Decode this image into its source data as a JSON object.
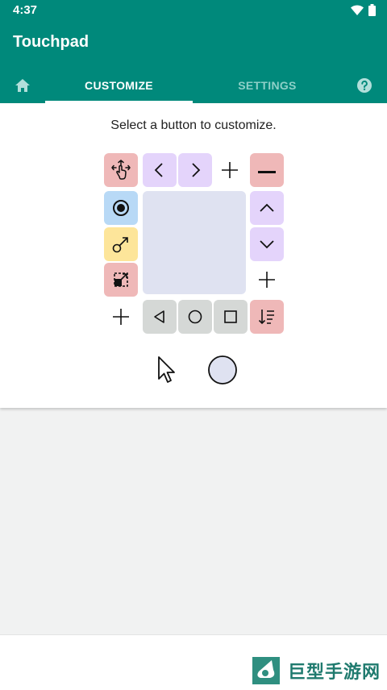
{
  "status_bar": {
    "time": "4:37",
    "wifi_icon": "wifi-icon",
    "battery_icon": "battery-icon"
  },
  "app": {
    "title": "Touchpad",
    "accent_color": "#00897b"
  },
  "tabs": [
    {
      "id": "home",
      "icon": "home-icon",
      "label": ""
    },
    {
      "id": "customize",
      "label": "CUSTOMIZE",
      "selected": true
    },
    {
      "id": "settings",
      "label": "SETTINGS",
      "selected": false
    },
    {
      "id": "help",
      "icon": "help-icon",
      "label": ""
    }
  ],
  "customize": {
    "instruction": "Select a button to customize.",
    "buttons": [
      {
        "name": "move-gesture",
        "icon": "hand-move-icon",
        "color": "#efb8b8"
      },
      {
        "name": "left",
        "icon": "chevron-left-icon",
        "color": "#e4d4fb"
      },
      {
        "name": "right",
        "icon": "chevron-right-icon",
        "color": "#e4d4fb"
      },
      {
        "name": "add-top",
        "icon": "plus-icon"
      },
      {
        "name": "minus",
        "icon": "minus-icon",
        "color": "#efb8b8"
      },
      {
        "name": "record",
        "icon": "radio-button-icon",
        "color": "#b8d9f6"
      },
      {
        "name": "up",
        "icon": "chevron-up-icon",
        "color": "#e4d4fb"
      },
      {
        "name": "pointer-drag",
        "icon": "pointer-drag-icon",
        "color": "#fde59a"
      },
      {
        "name": "down",
        "icon": "chevron-down-icon",
        "color": "#e4d4fb"
      },
      {
        "name": "resize",
        "icon": "resize-icon",
        "color": "#efb8b8"
      },
      {
        "name": "add-right",
        "icon": "plus-icon"
      },
      {
        "name": "add-bottom",
        "icon": "plus-icon"
      },
      {
        "name": "back",
        "icon": "triangle-back-icon",
        "color": "#d5d8d6"
      },
      {
        "name": "home",
        "icon": "circle-home-icon",
        "color": "#d5d8d6"
      },
      {
        "name": "recents",
        "icon": "square-recents-icon",
        "color": "#d5d8d6"
      },
      {
        "name": "sort",
        "icon": "sort-icon",
        "color": "#efb8b8"
      }
    ],
    "touch_area_color": "#dfe2f1",
    "cursor_icon": "cursor-arrow-icon",
    "circle_cursor_icon": "circle-cursor-icon"
  },
  "watermark": {
    "text": "巨型手游网"
  }
}
